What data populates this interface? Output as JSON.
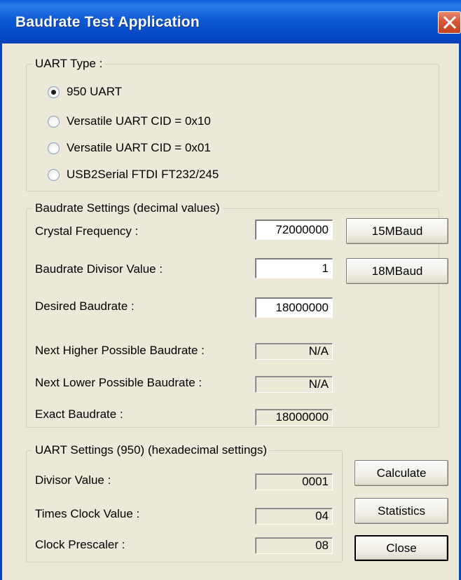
{
  "window": {
    "title": "Baudrate Test Application"
  },
  "uart_type": {
    "label": "UART Type :",
    "options": [
      {
        "label": "950 UART",
        "checked": true
      },
      {
        "label": "Versatile UART CID = 0x10",
        "checked": false
      },
      {
        "label": "Versatile UART CID = 0x01",
        "checked": false
      },
      {
        "label": "USB2Serial FTDI FT232/245",
        "checked": false
      }
    ]
  },
  "baudrate_settings": {
    "label": "Baudrate Settings (decimal values)",
    "crystal_frequency": {
      "label": "Crystal Frequency :",
      "value": "72000000"
    },
    "baudrate_divisor": {
      "label": "Baudrate Divisor Value :",
      "value": "1"
    },
    "desired_baudrate": {
      "label": "Desired Baudrate :",
      "value": "18000000"
    },
    "next_higher": {
      "label": "Next Higher Possible Baudrate :",
      "value": "N/A"
    },
    "next_lower": {
      "label": "Next Lower Possible Baudrate :",
      "value": "N/A"
    },
    "exact": {
      "label": "Exact Baudrate :",
      "value": "18000000"
    },
    "buttons": {
      "mbaud15": "15MBaud",
      "mbaud18": "18MBaud"
    }
  },
  "uart_settings": {
    "label": "UART Settings (950) (hexadecimal settings)",
    "divisor_value": {
      "label": "Divisor Value :",
      "value": "0001"
    },
    "times_clock": {
      "label": "Times Clock Value :",
      "value": "04"
    },
    "clock_prescaler": {
      "label": "Clock Prescaler :",
      "value": "08"
    }
  },
  "actions": {
    "calculate": "Calculate",
    "statistics": "Statistics",
    "close": "Close"
  },
  "icons": {
    "close": "close-icon"
  },
  "colors": {
    "titlebar": "#0646c4",
    "close_button": "#d8573a",
    "dialog_bg": "#ece9d8"
  }
}
